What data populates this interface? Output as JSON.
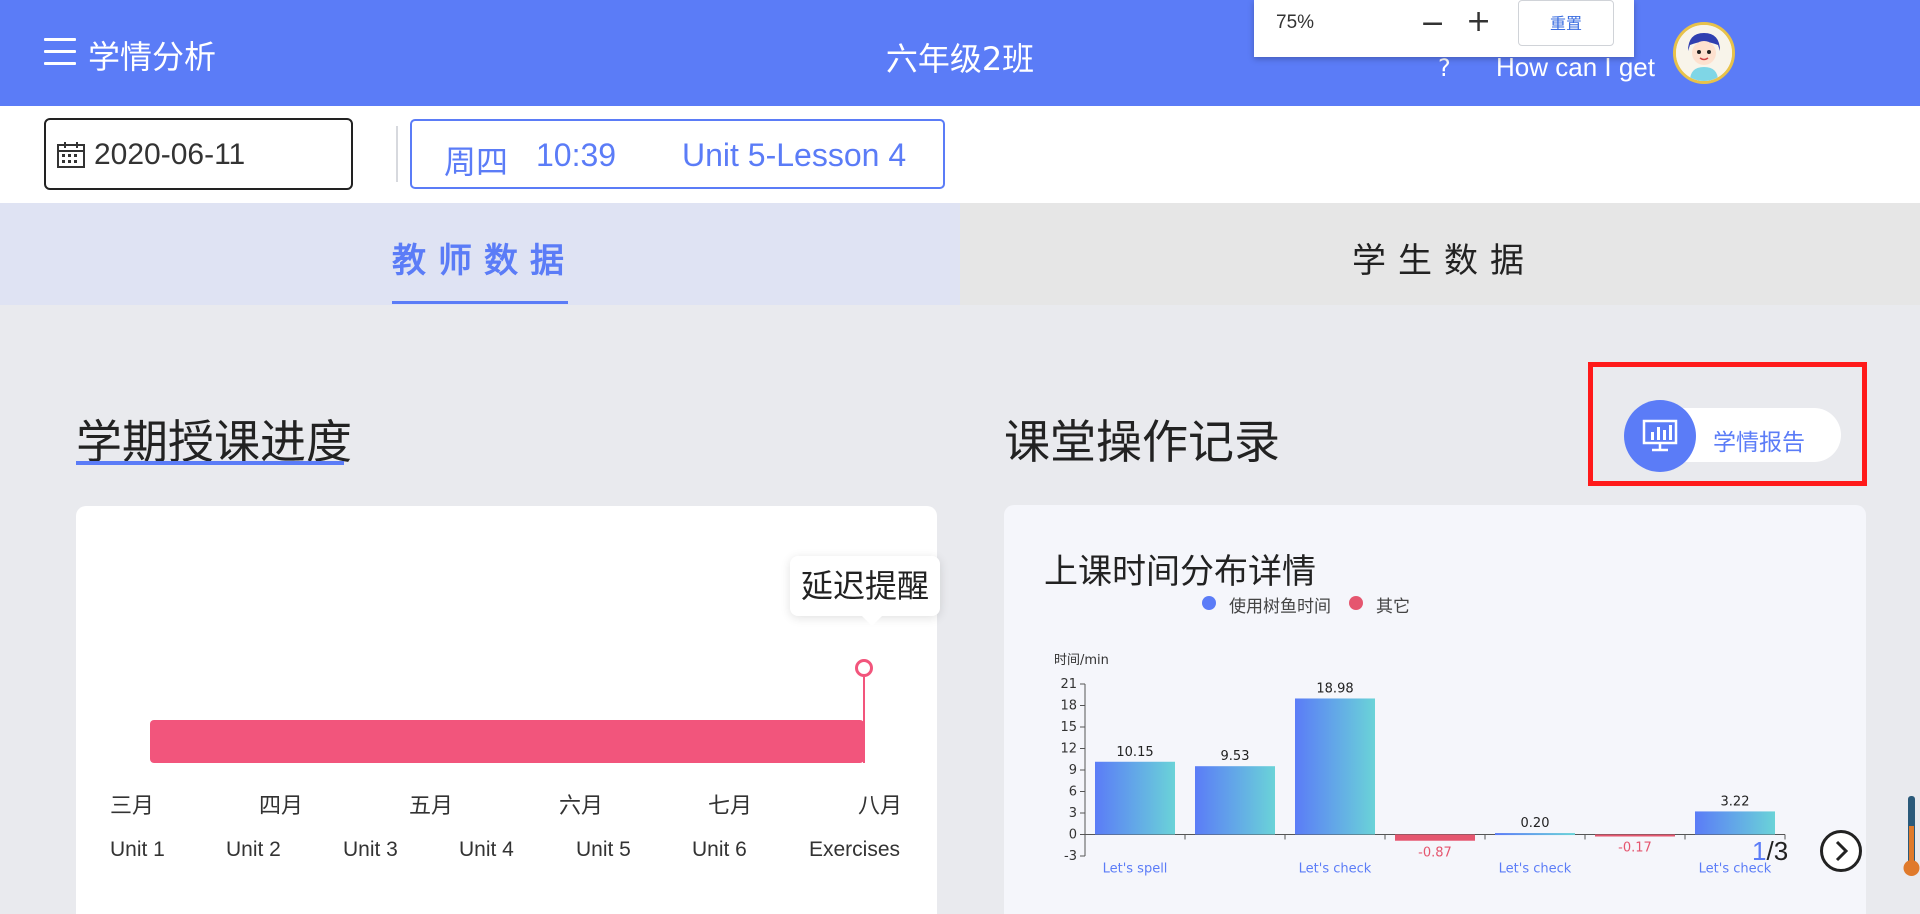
{
  "header": {
    "app_title": "学情分析",
    "class_name": "六年级2班",
    "help_link": "?",
    "help_text": "How can I get",
    "brand_color": "#5b7cf7"
  },
  "zoom": {
    "value": "75%",
    "minus": "−",
    "plus": "+",
    "reset": "重置"
  },
  "toolbar": {
    "date": "2020-06-11",
    "weekday": "周四",
    "time": "10:39",
    "lesson": "Unit 5-Lesson 4"
  },
  "tabs": [
    {
      "label": "教师数据",
      "active": true
    },
    {
      "label": "学生数据",
      "active": false
    }
  ],
  "progress": {
    "title": "学期授课进度",
    "delay_tip": "延迟提醒",
    "months": [
      "三月",
      "四月",
      "五月",
      "六月",
      "七月",
      "八月"
    ],
    "units": [
      "Unit 1",
      "Unit 2",
      "Unit 3",
      "Unit 4",
      "Unit 5",
      "Unit 6",
      "Exercises"
    ],
    "bar_color": "#f2557c"
  },
  "operations": {
    "title": "课堂操作记录",
    "report_button": "学情报告"
  },
  "chart": {
    "pager_current": "1",
    "pager_total": "/3"
  },
  "chart_data": {
    "type": "bar",
    "title": "上课时间分布详情",
    "ylabel": "时间/min",
    "ylim": [
      -3,
      21
    ],
    "yticks": [
      -3,
      0,
      3,
      6,
      9,
      12,
      15,
      18,
      21
    ],
    "categories": [
      "Let's spell",
      "",
      "Let's check",
      "",
      "Let's check",
      "",
      "Let's check"
    ],
    "series": [
      {
        "name": "使用树鱼时间",
        "color": "#5b7cf7",
        "values": [
          10.15,
          9.53,
          18.98,
          null,
          0.2,
          null,
          3.22
        ]
      },
      {
        "name": "其它",
        "color": "#e5566f",
        "values": [
          null,
          null,
          null,
          -0.87,
          null,
          -0.17,
          null
        ]
      }
    ],
    "legend_position": "top-center",
    "grid": false
  }
}
